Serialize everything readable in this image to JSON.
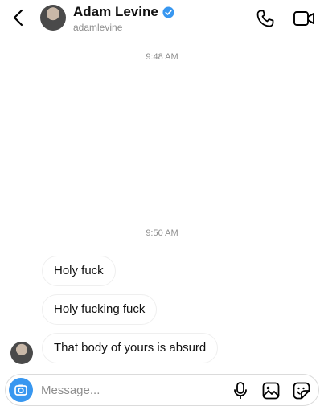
{
  "header": {
    "name": "Adam Levine",
    "username": "adamlevine",
    "verified": true,
    "accent_color": "#3897f0"
  },
  "timestamps": [
    "9:48 AM",
    "9:50 AM"
  ],
  "messages": [
    {
      "text": "Holy fuck"
    },
    {
      "text": "Holy fucking fuck"
    },
    {
      "text": "That body of yours is absurd"
    }
  ],
  "composer": {
    "placeholder": "Message..."
  },
  "icons": {
    "back": "chevron-left-icon",
    "call": "phone-icon",
    "video": "video-camera-icon",
    "camera": "camera-icon",
    "mic": "microphone-icon",
    "gallery": "image-icon",
    "sticker": "sticker-icon"
  }
}
